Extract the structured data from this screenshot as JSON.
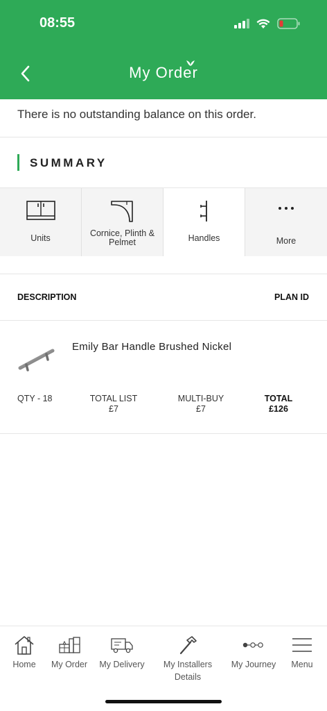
{
  "status_bar": {
    "time": "08:55"
  },
  "header": {
    "title": "My Order",
    "back_icon": "chevron-left-icon"
  },
  "balance_text": "There is no outstanding balance on this order.",
  "summary": {
    "title": "SUMMARY"
  },
  "tabs": [
    {
      "label": "Units",
      "icon": "cabinet-icon",
      "active": false
    },
    {
      "label": "Cornice, Plinth & Pelmet",
      "icon": "cornice-icon",
      "active": false
    },
    {
      "label": "Handles",
      "icon": "handle-icon",
      "active": true
    },
    {
      "label": "More",
      "icon": "more-dots-icon",
      "active": false
    }
  ],
  "table": {
    "col_description": "DESCRIPTION",
    "col_plan_id": "PLAN ID"
  },
  "item": {
    "name": "Emily Bar Handle Brushed Nickel",
    "qty": "QTY - 18",
    "total_list_label": "TOTAL LIST",
    "total_list_value": "£7",
    "multi_buy_label": "MULTI-BUY",
    "multi_buy_value": "£7",
    "total_label": "TOTAL",
    "total_value": "£126"
  },
  "bottom_nav": [
    {
      "label": "Home",
      "icon": "house-icon"
    },
    {
      "label": "My Order",
      "icon": "kitchen-icon"
    },
    {
      "label": "My Delivery",
      "icon": "truck-icon"
    },
    {
      "label": "My Installers",
      "label2": "Details",
      "icon": "hammer-icon"
    },
    {
      "label": "My Journey",
      "icon": "journey-icon"
    },
    {
      "label": "Menu",
      "icon": "hamburger-icon"
    }
  ],
  "colors": {
    "brand_green": "#2eaa57"
  }
}
